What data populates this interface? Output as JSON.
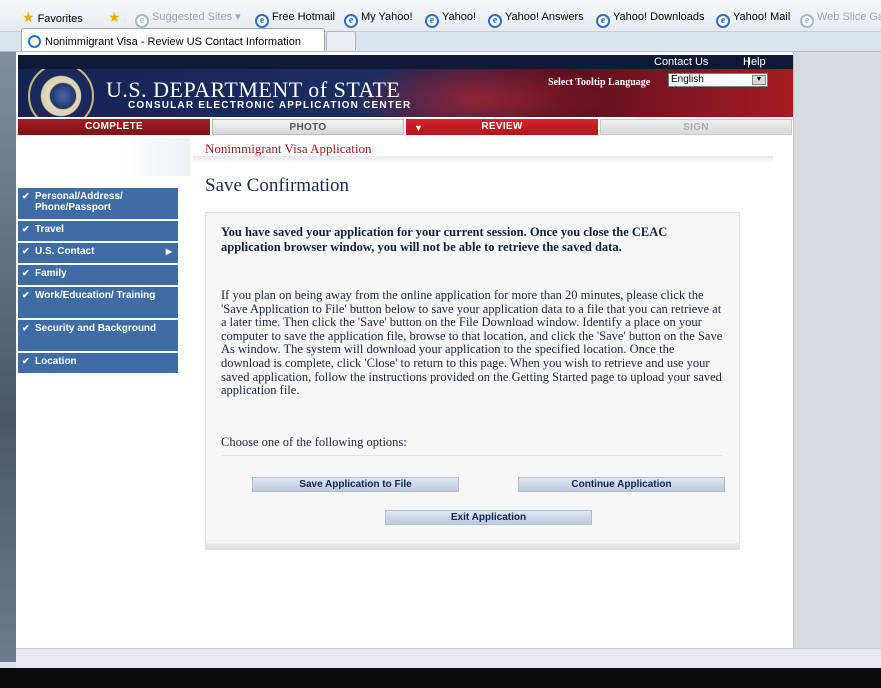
{
  "browser": {
    "favorites_label": "Favorites",
    "favorites": [
      {
        "label": "Suggested Sites ▾",
        "dim": true
      },
      {
        "label": "Free Hotmail"
      },
      {
        "label": "My Yahoo!"
      },
      {
        "label": "Yahoo!"
      },
      {
        "label": "Yahoo! Answers"
      },
      {
        "label": "Yahoo! Downloads"
      },
      {
        "label": "Yahoo! Mail"
      },
      {
        "label": "Web Slice Ga",
        "dim": true
      }
    ],
    "tab_title": "Nonimmigrant Visa - Review US Contact Information"
  },
  "header": {
    "contact_us": "Contact Us",
    "separator": "|",
    "help": "Help",
    "department": "U.S. DEPARTMENT of STATE",
    "subtitle": "CONSULAR ELECTRONIC APPLICATION CENTER",
    "tooltip_label": "Select Tooltip Language",
    "language": "English"
  },
  "progress_tabs": {
    "complete": "COMPLETE",
    "photo": "PHOTO",
    "review": "REVIEW",
    "sign": "SIGN"
  },
  "sidenav": {
    "items": [
      {
        "label": "Personal/Address/ Phone/Passport"
      },
      {
        "label": "Travel"
      },
      {
        "label": "U.S. Contact"
      },
      {
        "label": "Family"
      },
      {
        "label": "Work/Education/ Training"
      },
      {
        "label": "Security and Background"
      },
      {
        "label": "Location"
      }
    ]
  },
  "main": {
    "breadcrumb": "Nonimmigrant Visa Application",
    "title": "Save Confirmation",
    "bold_message": "You have saved your application for your current session. Once you close the CEAC application browser window, you will not be able to retrieve the saved data.",
    "info_message": "If you plan on being away from the online application for more than 20 minutes, please click the 'Save Application to File' button below to save your application data to a file that you can retrieve at a later time. Then click the 'Save' button on the File Download window. Identify a place on your computer to save the application file, browse to that location, and click the 'Save' button on the Save As window. The system will download your application to the specified location. Once the download is complete, click 'Close' to return to this page. When you wish to retrieve and use your saved application, follow the instructions provided on the Getting Started page to upload your saved application file.",
    "choose_label": "Choose one of the following options:",
    "buttons": {
      "save": "Save Application to File",
      "continue": "Continue Application",
      "exit": "Exit Application"
    }
  },
  "colors": {
    "nav_blue": "#3f6ca5",
    "review_red": "#c21c23",
    "title_navy": "#1b2a55",
    "breadcrumb_red": "#9a1a1a"
  }
}
